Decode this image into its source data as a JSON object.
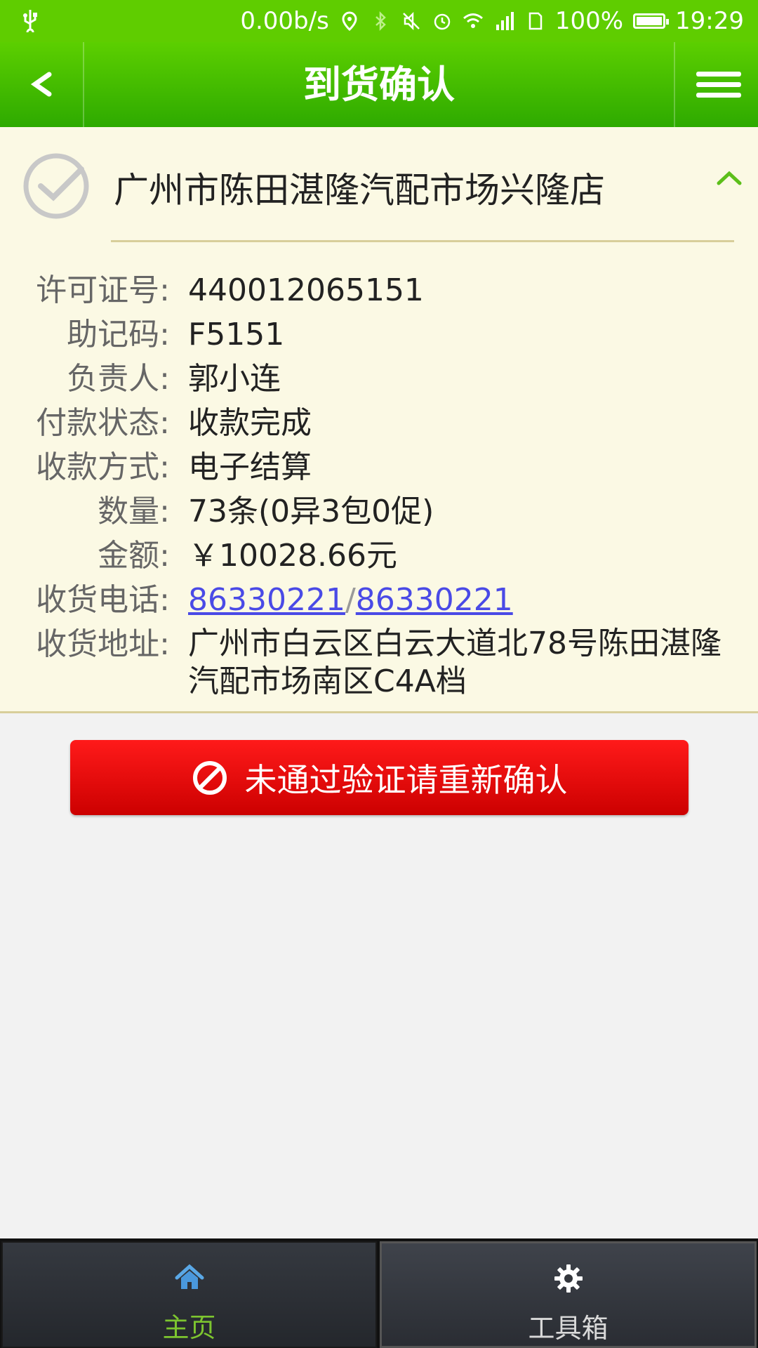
{
  "status_bar": {
    "net_speed": "0.00b/s",
    "battery": "100%",
    "time": "19:29"
  },
  "header": {
    "title": "到货确认"
  },
  "store": {
    "name": "广州市陈田湛隆汽配市场兴隆店"
  },
  "details": {
    "license_label": "许可证号:",
    "license_value": "440012065151",
    "mnemonic_label": "助记码:",
    "mnemonic_value": "F5151",
    "manager_label": "负责人:",
    "manager_value": "郭小连",
    "payment_status_label": "付款状态:",
    "payment_status_value": "收款完成",
    "payment_method_label": "收款方式:",
    "payment_method_value": "电子结算",
    "quantity_label": "数量:",
    "quantity_value": "73条(0异3包0促)",
    "amount_label": "金额:",
    "amount_value": "￥10028.66元",
    "phone_label": "收货电话:",
    "phone_1": "86330221",
    "phone_separator": "/",
    "phone_2": "86330221",
    "address_label": "收货地址:",
    "address_value": "广州市白云区白云大道北78号陈田湛隆汽配市场南区C4A档"
  },
  "action": {
    "confirm_label": "未通过验证请重新确认"
  },
  "bottom_nav": {
    "home_label": "主页",
    "tools_label": "工具箱"
  },
  "colors": {
    "header_green": "#2eaa00",
    "button_red": "#e00000",
    "active_tab": "#7dc52f",
    "link": "#4a4ae6"
  }
}
